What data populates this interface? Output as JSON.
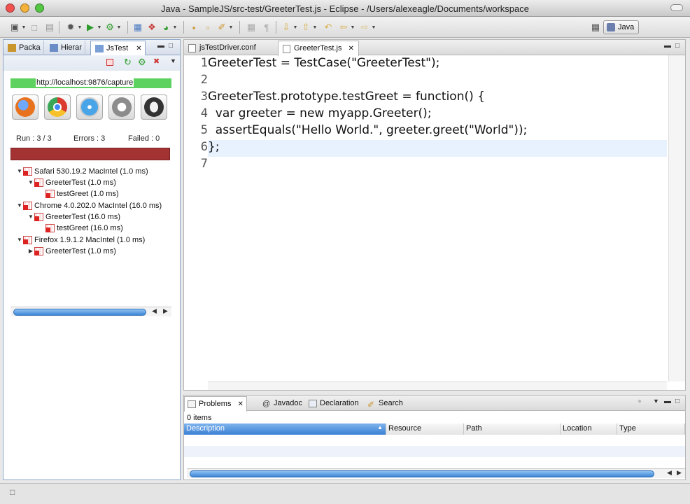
{
  "window": {
    "title": "Java - SampleJS/src-test/GreeterTest.js - Eclipse - /Users/alexeagle/Documents/workspace"
  },
  "perspective": {
    "label": "Java"
  },
  "left_panel": {
    "tabs": [
      {
        "label": "Packa"
      },
      {
        "label": "Hierar"
      },
      {
        "label": "JsTest"
      }
    ],
    "capture_url": "http://localhost:9876/capture",
    "browser_icons": [
      "firefox-icon",
      "chrome-icon",
      "safari-icon",
      "ie-icon",
      "opera-icon"
    ],
    "stats": {
      "run": "Run : 3 / 3",
      "errors": "Errors : 3",
      "failed": "Failed : 0"
    },
    "status_color": "#a33333",
    "tree": [
      {
        "label": "Safari 530.19.2 MacIntel (1.0 ms)",
        "level": 0,
        "expanded": true
      },
      {
        "label": "GreeterTest (1.0 ms)",
        "level": 1,
        "expanded": true
      },
      {
        "label": "testGreet (1.0 ms)",
        "level": 2
      },
      {
        "label": "Chrome 4.0.202.0 MacIntel (16.0 ms)",
        "level": 0,
        "expanded": true
      },
      {
        "label": "GreeterTest (16.0 ms)",
        "level": 1,
        "expanded": true
      },
      {
        "label": "testGreet (16.0 ms)",
        "level": 2
      },
      {
        "label": "Firefox 1.9.1.2 MacIntel (1.0 ms)",
        "level": 0,
        "expanded": true
      },
      {
        "label": "GreeterTest (1.0 ms)",
        "level": 1,
        "expanded": false
      }
    ]
  },
  "editor": {
    "tabs": [
      {
        "label": "jsTestDriver.conf",
        "active": false
      },
      {
        "label": "GreeterTest.js",
        "active": true
      }
    ],
    "lines": [
      {
        "num": "1",
        "text": "GreeterTest = TestCase(\"GreeterTest\");"
      },
      {
        "num": "2",
        "text": ""
      },
      {
        "num": "3",
        "text": "GreeterTest.prototype.testGreet = function() {"
      },
      {
        "num": "4",
        "text": "  var greeter = new myapp.Greeter();"
      },
      {
        "num": "5",
        "text": "  assertEquals(\"Hello World.\", greeter.greet(\"World\"));"
      },
      {
        "num": "6",
        "text": "};"
      },
      {
        "num": "7",
        "text": ""
      }
    ]
  },
  "problems_panel": {
    "tabs": [
      {
        "label": "Problems",
        "active": true
      },
      {
        "label": "Javadoc",
        "active": false
      },
      {
        "label": "Declaration",
        "active": false
      },
      {
        "label": "Search",
        "active": false
      }
    ],
    "items_count": "0 items",
    "columns": [
      "Description",
      "Resource",
      "Path",
      "Location",
      "Type"
    ]
  }
}
